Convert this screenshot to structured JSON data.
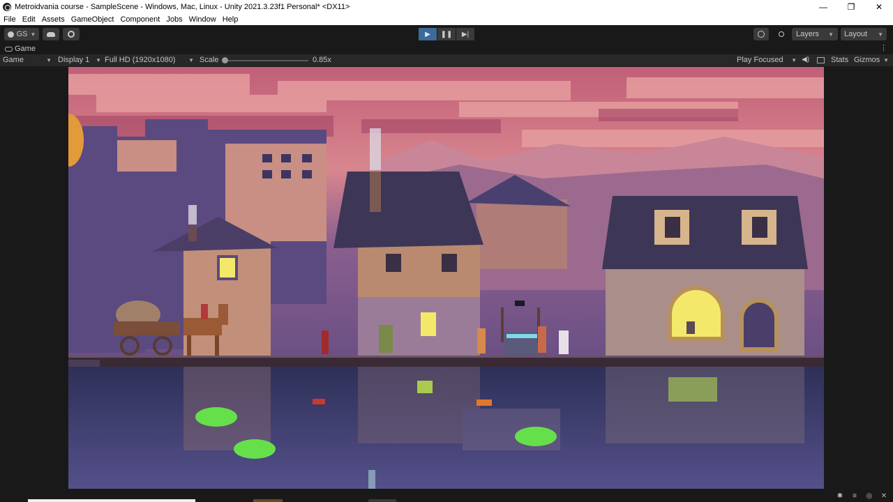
{
  "window": {
    "title": "Metroidvania course - SampleScene - Windows, Mac, Linux - Unity 2021.3.23f1 Personal* <DX11>",
    "minimize_glyph": "—",
    "maximize_glyph": "❐",
    "close_glyph": "✕"
  },
  "menu": {
    "items": [
      "File",
      "Edit",
      "Assets",
      "GameObject",
      "Component",
      "Jobs",
      "Window",
      "Help"
    ]
  },
  "toolbar": {
    "account_label": "GS",
    "layers_label": "Layers",
    "layout_label": "Layout"
  },
  "tabs": {
    "game_tab_label": "Game"
  },
  "game_toolbar": {
    "view_mode": "Game",
    "display": "Display 1",
    "resolution": "Full HD (1920x1080)",
    "scale_label": "Scale",
    "scale_value": "0.85x",
    "play_mode": "Play Focused",
    "stats_label": "Stats",
    "gizmos_label": "Gizmos"
  },
  "colors": {
    "accent_play": "#3d6a98",
    "sky_top": "#c9667a",
    "sky_bottom": "#e4a1a3",
    "water": "#3e3a6a"
  },
  "icons": {
    "account": "person-icon",
    "cloud": "cloud-icon",
    "collab": "target-icon",
    "play": "play-icon",
    "pause": "pause-icon",
    "step": "step-icon",
    "history": "history-icon",
    "search": "search-icon",
    "audio": "speaker-icon",
    "stats": "stats-icon"
  }
}
